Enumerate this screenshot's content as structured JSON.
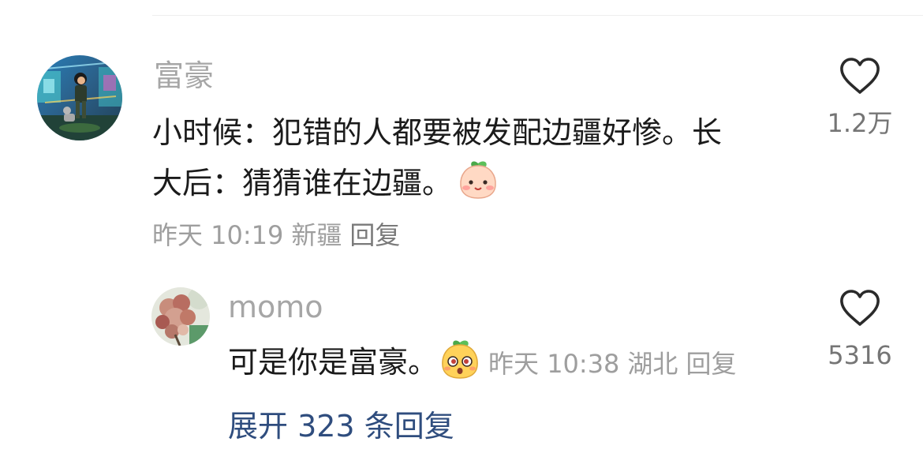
{
  "main_comment": {
    "username": "富豪",
    "text_line1": "小时候：犯错的人都要被发配边疆好惨。长",
    "text_line2": "大后：猜猜谁在边疆。",
    "emoji_icon": "blushing-peach-face-emoji",
    "time": "昨天 10:19",
    "location": "新疆",
    "reply_label": "回复",
    "like_count": "1.2万"
  },
  "reply_comment": {
    "username": "momo",
    "text": "可是你是富豪。",
    "emoji_icon": "surprised-peach-face-emoji",
    "time": "昨天 10:38",
    "location": "湖北",
    "reply_label": "回复",
    "like_count": "5316"
  },
  "expand_label": "展开 323 条回复",
  "colors": {
    "username": "#a6a6a6",
    "body_text": "#1b1b1b",
    "meta_text": "#9e9e9e",
    "expand_link": "#2f4d7e"
  }
}
